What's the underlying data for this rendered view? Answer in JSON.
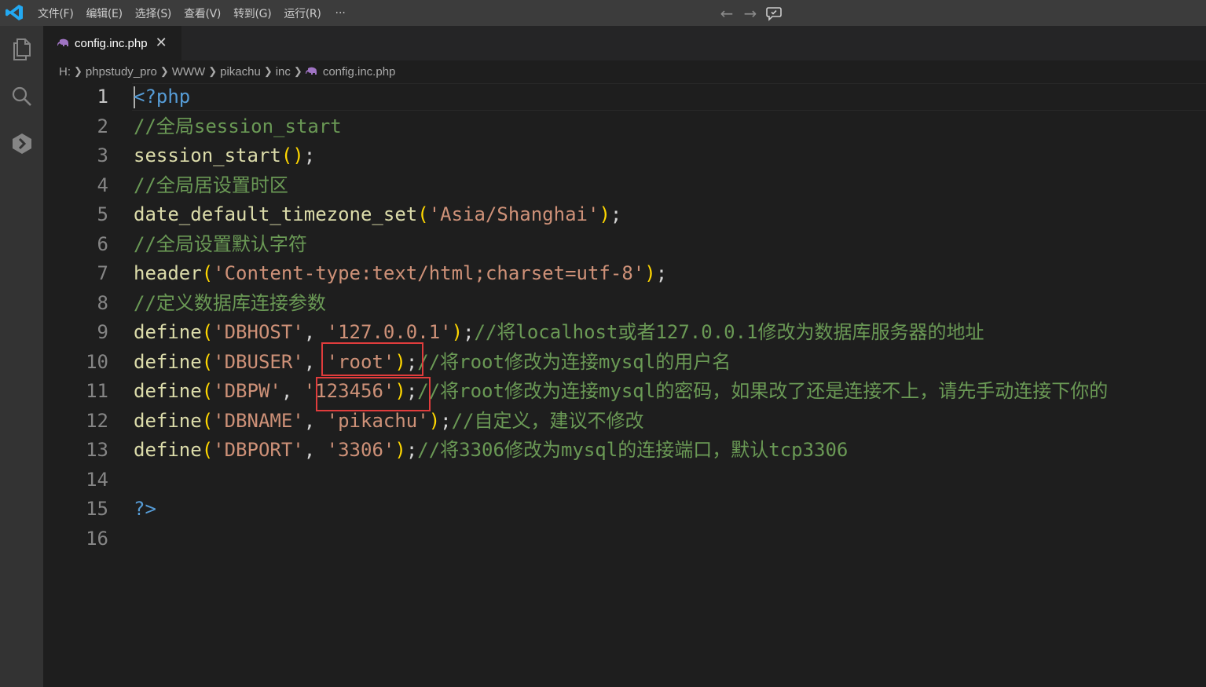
{
  "titlebar": {
    "menu": [
      "文件(F)",
      "编辑(E)",
      "选择(S)",
      "查看(V)",
      "转到(G)",
      "运行(R)"
    ],
    "more": "···",
    "back": "←",
    "forward": "→"
  },
  "tab": {
    "label": "config.inc.php",
    "close": "✕"
  },
  "breadcrumb": [
    "H:",
    "phpstudy_pro",
    "WWW",
    "pikachu",
    "inc",
    "config.inc.php"
  ],
  "editor": {
    "active_line": 1,
    "lines": [
      {
        "n": "1",
        "tokens": [
          [
            "tag",
            "<?php"
          ]
        ]
      },
      {
        "n": "2",
        "tokens": [
          [
            "cm",
            "//全局session_start"
          ]
        ]
      },
      {
        "n": "3",
        "tokens": [
          [
            "fn",
            "session_start"
          ],
          [
            "br",
            "()"
          ],
          [
            "pl",
            ";"
          ]
        ]
      },
      {
        "n": "4",
        "tokens": [
          [
            "cm",
            "//全局居设置时区"
          ]
        ]
      },
      {
        "n": "5",
        "tokens": [
          [
            "fn",
            "date_default_timezone_set"
          ],
          [
            "br",
            "("
          ],
          [
            "str",
            "'Asia/Shanghai'"
          ],
          [
            "br",
            ")"
          ],
          [
            "pl",
            ";"
          ]
        ]
      },
      {
        "n": "6",
        "tokens": [
          [
            "cm",
            "//全局设置默认字符"
          ]
        ]
      },
      {
        "n": "7",
        "tokens": [
          [
            "fn",
            "header"
          ],
          [
            "br",
            "("
          ],
          [
            "str",
            "'Content-type:text/html;charset=utf-8'"
          ],
          [
            "br",
            ")"
          ],
          [
            "pl",
            ";"
          ]
        ]
      },
      {
        "n": "8",
        "tokens": [
          [
            "cm",
            "//定义数据库连接参数"
          ]
        ]
      },
      {
        "n": "9",
        "tokens": [
          [
            "fn",
            "define"
          ],
          [
            "br",
            "("
          ],
          [
            "str",
            "'DBHOST'"
          ],
          [
            "pl",
            ", "
          ],
          [
            "str",
            "'127.0.0.1'"
          ],
          [
            "br",
            ")"
          ],
          [
            "pl",
            ";"
          ],
          [
            "cm",
            "//将localhost或者127.0.0.1修改为数据库服务器的地址"
          ]
        ]
      },
      {
        "n": "10",
        "tokens": [
          [
            "fn",
            "define"
          ],
          [
            "br",
            "("
          ],
          [
            "str",
            "'DBUSER'"
          ],
          [
            "pl",
            ", "
          ],
          [
            "str",
            "'root'"
          ],
          [
            "br",
            ")"
          ],
          [
            "pl",
            ";"
          ],
          [
            "cm",
            "//将root修改为连接mysql的用户名"
          ]
        ]
      },
      {
        "n": "11",
        "tokens": [
          [
            "fn",
            "define"
          ],
          [
            "br",
            "("
          ],
          [
            "str",
            "'DBPW'"
          ],
          [
            "pl",
            ", "
          ],
          [
            "str",
            "'123456'"
          ],
          [
            "br",
            ")"
          ],
          [
            "pl",
            ";"
          ],
          [
            "cm",
            "//将root修改为连接mysql的密码，如果改了还是连接不上，请先手动连接下你的"
          ]
        ]
      },
      {
        "n": "12",
        "tokens": [
          [
            "fn",
            "define"
          ],
          [
            "br",
            "("
          ],
          [
            "str",
            "'DBNAME'"
          ],
          [
            "pl",
            ", "
          ],
          [
            "str",
            "'pikachu'"
          ],
          [
            "br",
            ")"
          ],
          [
            "pl",
            ";"
          ],
          [
            "cm",
            "//自定义，建议不修改"
          ]
        ]
      },
      {
        "n": "13",
        "tokens": [
          [
            "fn",
            "define"
          ],
          [
            "br",
            "("
          ],
          [
            "str",
            "'DBPORT'"
          ],
          [
            "pl",
            ", "
          ],
          [
            "str",
            "'3306'"
          ],
          [
            "br",
            ")"
          ],
          [
            "pl",
            ";"
          ],
          [
            "cm",
            "//将3306修改为mysql的连接端口，默认tcp3306"
          ]
        ]
      },
      {
        "n": "14",
        "tokens": []
      },
      {
        "n": "15",
        "tokens": [
          [
            "tag",
            "?>"
          ]
        ]
      },
      {
        "n": "16",
        "tokens": []
      }
    ]
  },
  "colors": {
    "highlight_box": "#e03c3c",
    "vscode_blue": "#23a9f2",
    "php_icon": "#a074c4"
  }
}
